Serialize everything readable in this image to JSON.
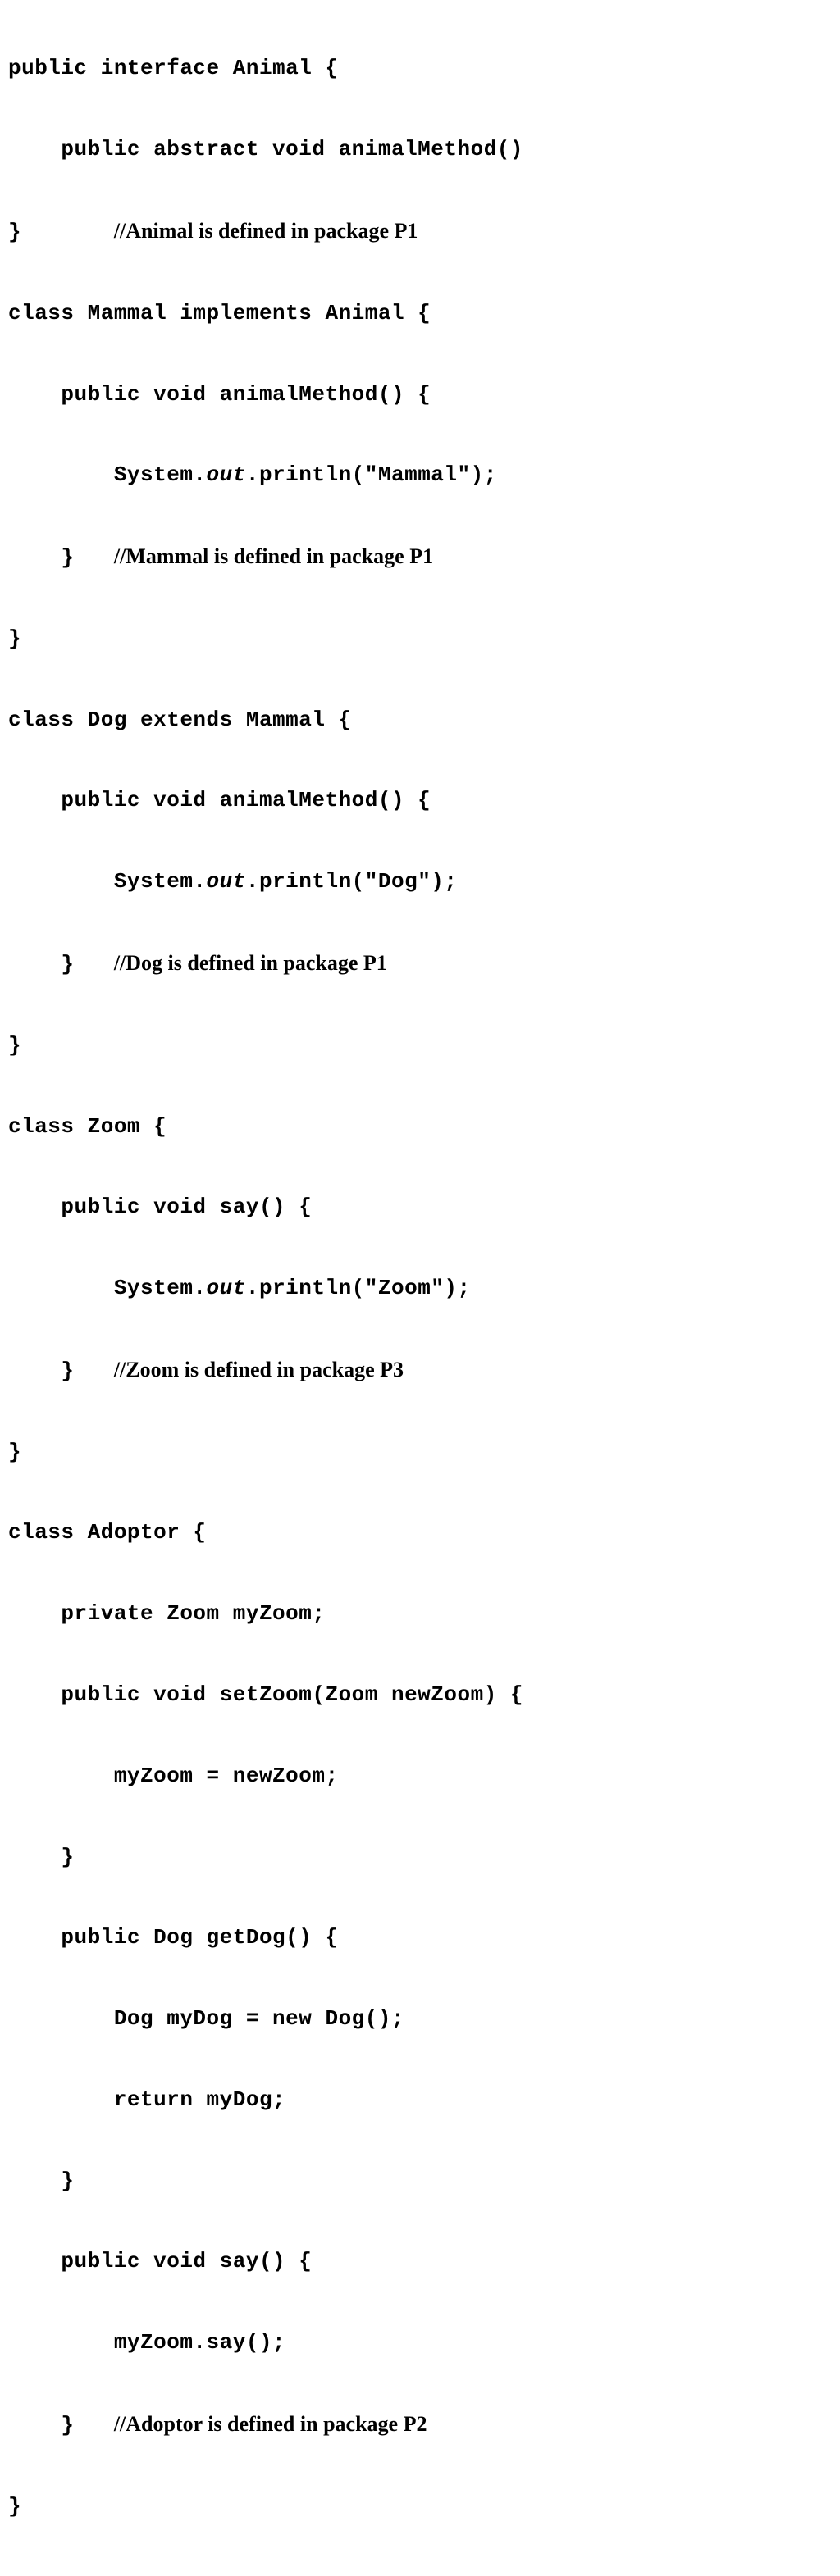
{
  "lines": {
    "l1": "public interface Animal {",
    "l2": "    public abstract void animalMethod()",
    "l3a": "}       ",
    "l3b": "//Animal is defined in package P1",
    "l4": "class Mammal implements Animal {",
    "l5": "    public void animalMethod() {",
    "l6a": "        System.",
    "l6b": "out",
    "l6c": ".println(\"Mammal\");",
    "l7a": "    }   ",
    "l7b": "//Mammal is defined in package P1",
    "l8": "}",
    "l9": "class Dog extends Mammal {",
    "l10": "    public void animalMethod() {",
    "l11a": "        System.",
    "l11b": "out",
    "l11c": ".println(\"Dog\");",
    "l12a": "    }   ",
    "l12b": "//Dog is defined in package P1",
    "l13": "}",
    "l14": "class Zoom {",
    "l15": "    public void say() {",
    "l16a": "        System.",
    "l16b": "out",
    "l16c": ".println(\"Zoom\");",
    "l17a": "    }   ",
    "l17b": "//Zoom is defined in package P3",
    "l18": "}",
    "l19": "class Adoptor {",
    "l20": "    private Zoom myZoom;",
    "l21": "    public void setZoom(Zoom newZoom) {",
    "l22": "        myZoom = newZoom;",
    "l23": "    }",
    "l24": "    public Dog getDog() {",
    "l25": "        Dog myDog = new Dog();",
    "l26": "        return myDog;",
    "l27": "    }",
    "l28": "    public void say() {",
    "l29": "        myZoom.say();",
    "l30a": "    }   ",
    "l30b": "//Adoptor is defined in package P2",
    "l31": "}"
  }
}
